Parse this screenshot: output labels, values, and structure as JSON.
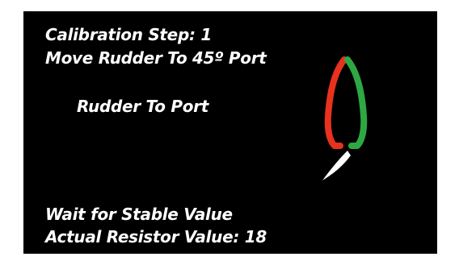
{
  "calibration": {
    "step_label": "Calibration Step:",
    "step_number": "1",
    "instruction": "Move Rudder To 45º Port",
    "direction_text": "Rudder To Port",
    "wait_text": "Wait for Stable Value",
    "resistor_label": "Actual Resistor Value:",
    "resistor_value": "18"
  },
  "graphic": {
    "icon": "boat-hull-with-rudder-icon",
    "port_color": "#e8321e",
    "starboard_color": "#2ea843",
    "rudder_color": "#ffffff"
  },
  "colors": {
    "background": "#000000",
    "text": "#ffffff"
  }
}
